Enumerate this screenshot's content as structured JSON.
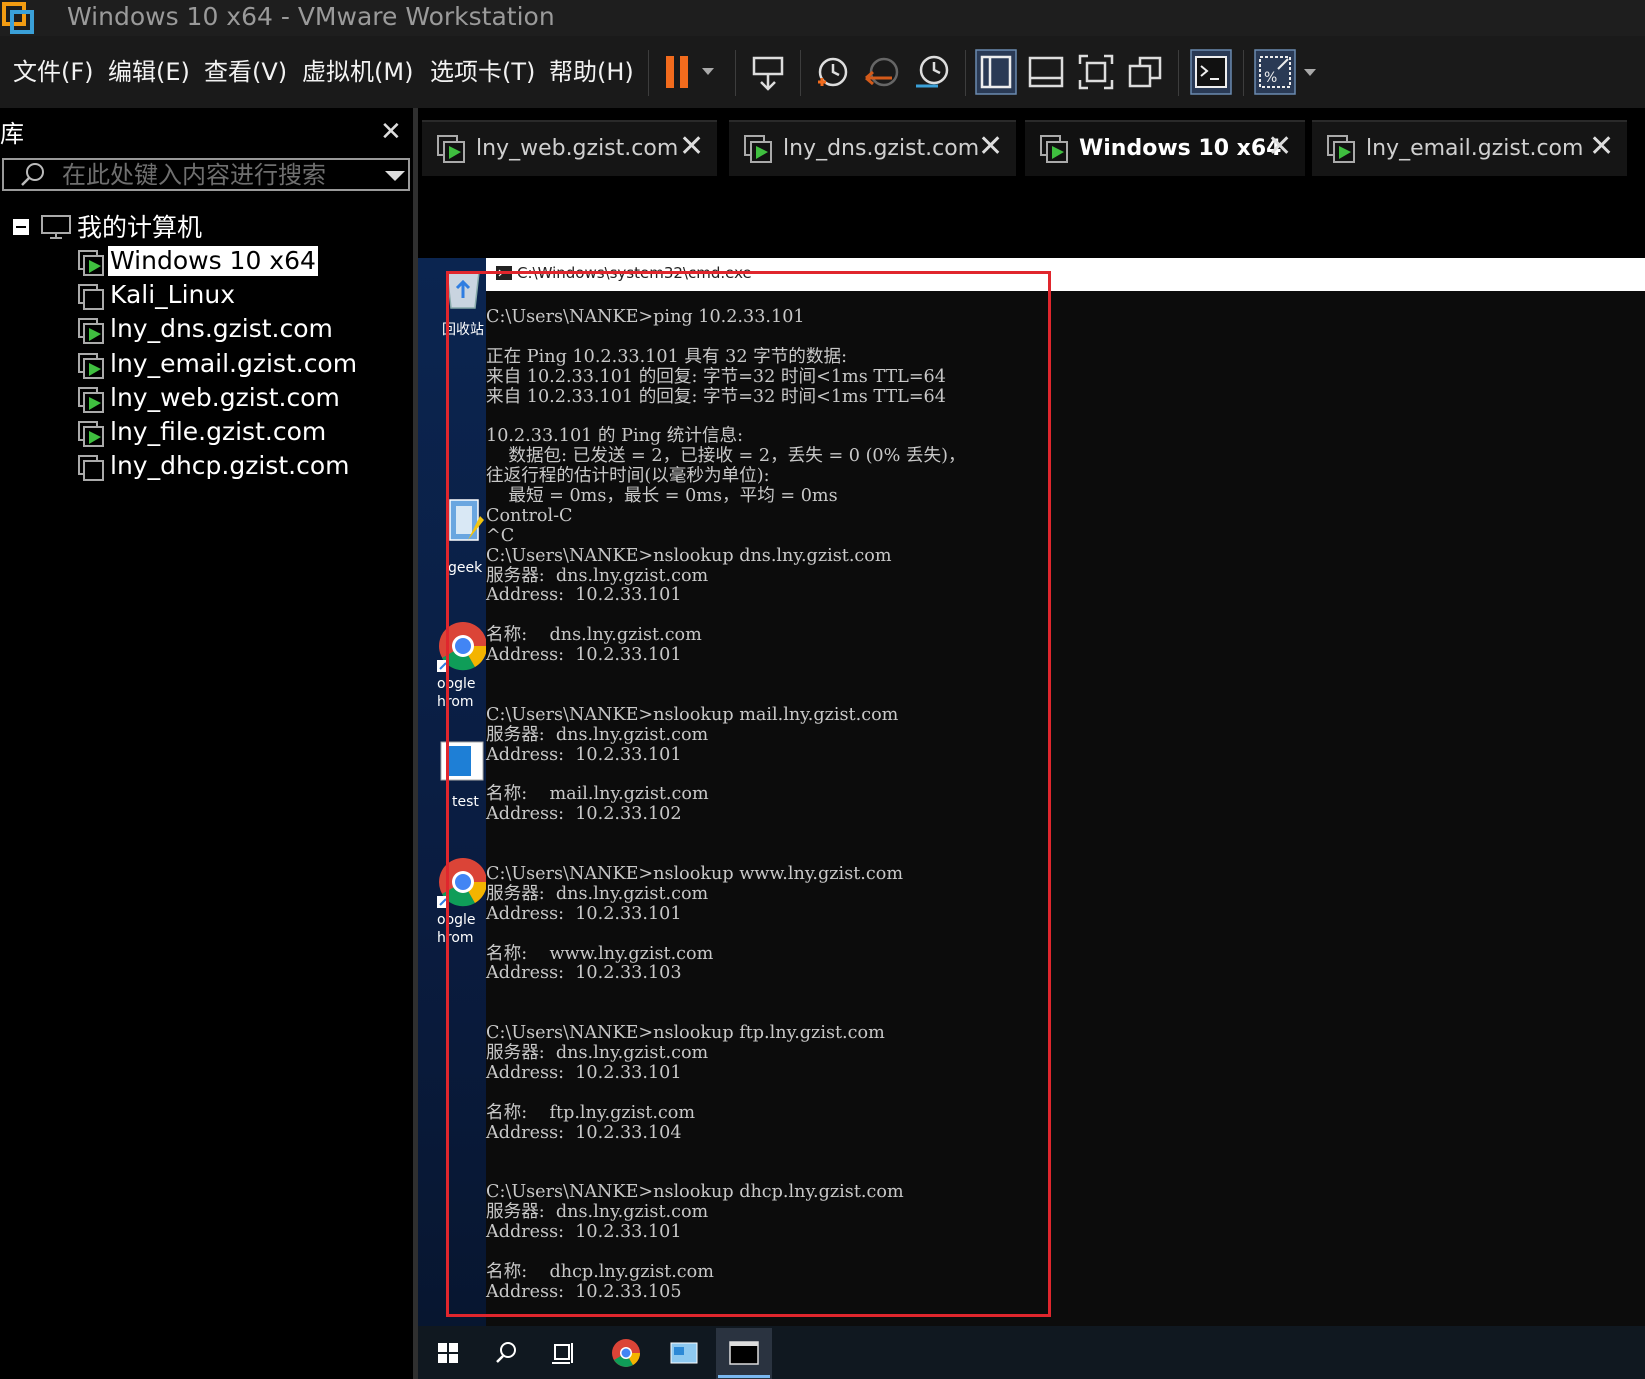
{
  "window": {
    "title": "Windows 10 x64 - VMware Workstation"
  },
  "menu": [
    {
      "label": "文件(F)"
    },
    {
      "label": "编辑(E)"
    },
    {
      "label": "查看(V)"
    },
    {
      "label": "虚拟机(M)"
    },
    {
      "label": "选项卡(T)"
    },
    {
      "label": "帮助(H)"
    }
  ],
  "toolbar": {
    "icons": [
      "pause-icon",
      "send-keys-icon",
      "snapshot-icon",
      "revert-snapshot-icon",
      "snapshot-manager-icon",
      "library-view-icon",
      "thumbnail-view-icon",
      "fullscreen-icon",
      "unity-icon",
      "console-icon",
      "stretch-icon"
    ]
  },
  "library": {
    "title": "库",
    "search_placeholder": "在此处键入内容进行搜索",
    "root": "我的计算机",
    "items": [
      {
        "label": "Windows 10 x64",
        "running": true,
        "selected": true
      },
      {
        "label": "Kali_Linux",
        "running": false
      },
      {
        "label": "lny_dns.gzist.com",
        "running": true
      },
      {
        "label": "lny_email.gzist.com",
        "running": true
      },
      {
        "label": "lny_web.gzist.com",
        "running": true
      },
      {
        "label": "lny_file.gzist.com",
        "running": true
      },
      {
        "label": "lny_dhcp.gzist.com",
        "running": false
      }
    ]
  },
  "tabs": [
    {
      "label": "lny_web.gzist.com",
      "active": false
    },
    {
      "label": "lny_dns.gzist.com",
      "active": false
    },
    {
      "label": "Windows 10 x64",
      "active": true
    },
    {
      "label": "lny_email.gzist.com",
      "active": false
    }
  ],
  "cmd": {
    "title": "C:\\Windows\\system32\\cmd.exe",
    "lines": [
      "C:\\Users\\NANKE>ping 10.2.33.101",
      "",
      "正在 Ping 10.2.33.101 具有 32 字节的数据:",
      "来自 10.2.33.101 的回复: 字节=32 时间<1ms TTL=64",
      "来自 10.2.33.101 的回复: 字节=32 时间<1ms TTL=64",
      "",
      "10.2.33.101 的 Ping 统计信息:",
      "    数据包: 已发送 = 2，已接收 = 2，丢失 = 0 (0% 丢失)，",
      "往返行程的估计时间(以毫秒为单位):",
      "    最短 = 0ms，最长 = 0ms，平均 = 0ms",
      "Control-C",
      "^C",
      "C:\\Users\\NANKE>nslookup dns.lny.gzist.com",
      "服务器:  dns.lny.gzist.com",
      "Address:  10.2.33.101",
      "",
      "名称:    dns.lny.gzist.com",
      "Address:  10.2.33.101",
      "",
      "",
      "C:\\Users\\NANKE>nslookup mail.lny.gzist.com",
      "服务器:  dns.lny.gzist.com",
      "Address:  10.2.33.101",
      "",
      "名称:    mail.lny.gzist.com",
      "Address:  10.2.33.102",
      "",
      "",
      "C:\\Users\\NANKE>nslookup www.lny.gzist.com",
      "服务器:  dns.lny.gzist.com",
      "Address:  10.2.33.101",
      "",
      "名称:    www.lny.gzist.com",
      "Address:  10.2.33.103",
      "",
      "",
      "C:\\Users\\NANKE>nslookup ftp.lny.gzist.com",
      "服务器:  dns.lny.gzist.com",
      "Address:  10.2.33.101",
      "",
      "名称:    ftp.lny.gzist.com",
      "Address:  10.2.33.104",
      "",
      "",
      "C:\\Users\\NANKE>nslookup dhcp.lny.gzist.com",
      "服务器:  dns.lny.gzist.com",
      "Address:  10.2.33.101",
      "",
      "名称:    dhcp.lny.gzist.com",
      "Address:  10.2.33.105"
    ]
  },
  "desktop_icons": [
    {
      "label": "回收站"
    },
    {
      "label": "geek"
    },
    {
      "label": "Google Chrome",
      "label_lines": [
        "oogle",
        "hrom"
      ]
    },
    {
      "label": "test"
    },
    {
      "label": "Google Chrome",
      "label_lines": [
        "oogle",
        "hrom"
      ]
    }
  ],
  "taskbar": [
    "windows-start-icon",
    "search-icon",
    "task-view-icon",
    "chrome-icon",
    "explorer-icon",
    "cmd-icon"
  ],
  "colors": {
    "highlight_box": "#e0262d",
    "running_vm": "#3fbf3f",
    "pause": "#f26b1d"
  }
}
